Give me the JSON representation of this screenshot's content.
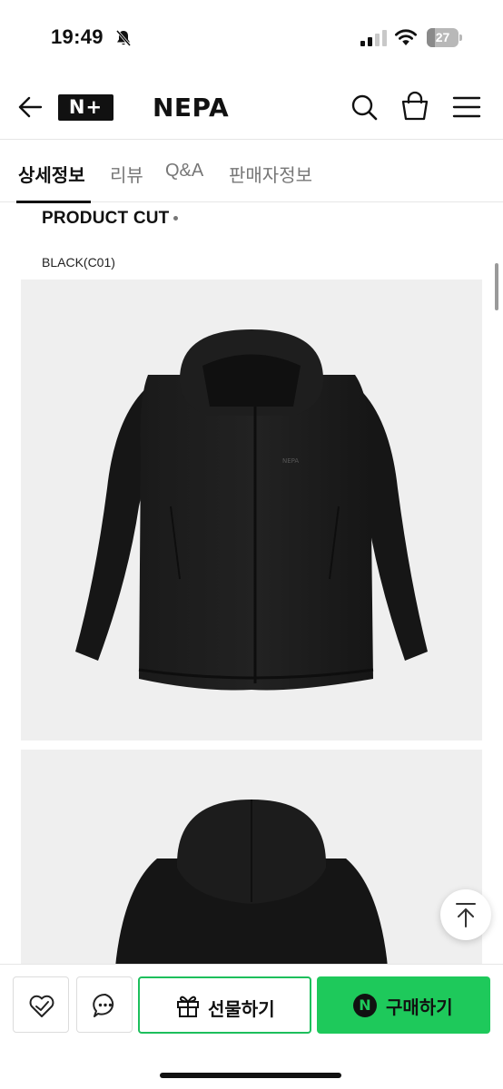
{
  "status_bar": {
    "time": "19:49",
    "battery_level": "27",
    "battery_fraction": 0.27,
    "icons": [
      "bell-slash-icon",
      "signal-icon",
      "wifi-icon",
      "battery-icon"
    ]
  },
  "header": {
    "back_icon": "arrow-left-icon",
    "nplus_logo": "N+",
    "brand_logo": "NEPA",
    "search_icon": "search-icon",
    "bag_icon": "shopping-bag-icon",
    "menu_icon": "hamburger-menu-icon"
  },
  "tabs": [
    {
      "label": "상세정보",
      "active": true
    },
    {
      "label": "리뷰",
      "active": false
    },
    {
      "label": "Q&A",
      "active": false
    },
    {
      "label": "판매자정보",
      "active": false
    }
  ],
  "content": {
    "section_title": "PRODUCT CUT",
    "color_label": "BLACK(C01)",
    "jacket_logo_text": "NEPA"
  },
  "bottom_bar": {
    "wish_icon": "heart-check-icon",
    "chat_icon": "chat-bubble-icon",
    "gift_label": "선물하기",
    "gift_icon": "gift-icon",
    "buy_label": "구매하기",
    "npay_badge": "N"
  },
  "colors": {
    "accent_green": "#1ec95b",
    "gift_border": "#1dbf5c",
    "text_primary": "#111111",
    "text_secondary": "#777777"
  }
}
